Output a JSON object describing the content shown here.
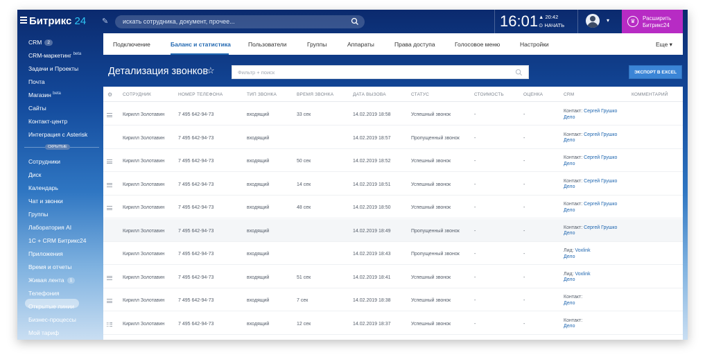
{
  "app": {
    "logo_main": "Битрикс",
    "logo_num": " 24",
    "search_placeholder": "искать сотрудника, документ, прочее...",
    "time": "16:01",
    "workday_time": "▲ 20:42",
    "workday_action": "⊙ НАЧАТЬ",
    "upgrade_line1": "Расширить",
    "upgrade_line2": "Битрикс24"
  },
  "sidebar": {
    "items": [
      {
        "label": "CRM",
        "badge": "2",
        "sup": ""
      },
      {
        "label": "CRM-маркетинг",
        "badge": "",
        "sup": "beta"
      },
      {
        "label": "Задачи и Проекты",
        "badge": "",
        "sup": ""
      },
      {
        "label": "Почта",
        "badge": "",
        "sup": ""
      },
      {
        "label": "Магазин",
        "badge": "",
        "sup": "beta"
      },
      {
        "label": "Сайты",
        "badge": "",
        "sup": ""
      },
      {
        "label": "Контакт-центр",
        "badge": "",
        "sup": ""
      },
      {
        "label": "Интеграция с Asterisk",
        "badge": "",
        "sup": ""
      }
    ],
    "hidden_label": "СКРЫТЫЕ",
    "hidden_items": [
      {
        "label": "Сотрудники",
        "badge": ""
      },
      {
        "label": "Диск",
        "badge": ""
      },
      {
        "label": "Календарь",
        "badge": ""
      },
      {
        "label": "Чат и звонки",
        "badge": ""
      },
      {
        "label": "Группы",
        "badge": ""
      },
      {
        "label": "Лаборатория AI",
        "badge": ""
      },
      {
        "label": "1С + CRM Битрикс24",
        "badge": ""
      },
      {
        "label": "Приложения",
        "badge": ""
      },
      {
        "label": "Время и отчеты",
        "badge": ""
      },
      {
        "label": "Живая лента",
        "badge": "1"
      },
      {
        "label": "Телефония",
        "badge": ""
      },
      {
        "label": "Открытые линии",
        "badge": ""
      },
      {
        "label": "Бизнес-процессы",
        "badge": ""
      },
      {
        "label": "Мой тариф",
        "badge": ""
      }
    ],
    "active_index": 10
  },
  "tabs": [
    {
      "label": "Подключение"
    },
    {
      "label": "Баланс и статистика"
    },
    {
      "label": "Пользователи"
    },
    {
      "label": "Группы"
    },
    {
      "label": "Аппараты"
    },
    {
      "label": "Права доступа"
    },
    {
      "label": "Голосовое меню"
    },
    {
      "label": "Настройки"
    },
    {
      "label": "Еще ▾"
    }
  ],
  "active_tab": 1,
  "page": {
    "title": "Детализация звонков",
    "filter_placeholder": "Фильтр + поиск",
    "excel_button": "ЭКСПОРТ В EXCEL"
  },
  "columns": [
    "СОТРУДНИК",
    "НОМЕР ТЕЛЕФОНА",
    "ТИП ЗВОНКА",
    "ВРЕМЯ ЗВОНКА",
    "ДАТА ВЫЗОВА",
    "СТАТУС",
    "СТОИМОСТЬ",
    "ОЦЕНКА",
    "CRM",
    "КОММЕНТАРИЙ"
  ],
  "rows": [
    {
      "handle": true,
      "employee": "Кирилл Золотавин",
      "phone": "7 495 642-94-73",
      "type": "входящий",
      "duration": "33 сек",
      "date": "14.02.2019 18:58",
      "status": "Успешный звонок",
      "cost": "-",
      "rating": "-",
      "crm_label": "Контакт: ",
      "crm_link": "Сергей Грушко",
      "crm_deal": "Дело",
      "comment": ""
    },
    {
      "handle": false,
      "employee": "Кирилл Золотавин",
      "phone": "7 495 642-94-73",
      "type": "входящий",
      "duration": "",
      "date": "14.02.2019 18:57",
      "status": "Пропущенный звонок",
      "cost": "-",
      "rating": "-",
      "crm_label": "Контакт: ",
      "crm_link": "Сергей Грушко",
      "crm_deal": "Дело",
      "comment": ""
    },
    {
      "handle": true,
      "employee": "Кирилл Золотавин",
      "phone": "7 495 642-94-73",
      "type": "входящий",
      "duration": "50 сек",
      "date": "14.02.2019 18:52",
      "status": "Успешный звонок",
      "cost": "-",
      "rating": "-",
      "crm_label": "Контакт: ",
      "crm_link": "Сергей Грушко",
      "crm_deal": "Дело",
      "comment": ""
    },
    {
      "handle": true,
      "employee": "Кирилл Золотавин",
      "phone": "7 495 642-94-73",
      "type": "входящий",
      "duration": "14 сек",
      "date": "14.02.2019 18:51",
      "status": "Успешный звонок",
      "cost": "-",
      "rating": "-",
      "crm_label": "Контакт: ",
      "crm_link": "Сергей Грушко",
      "crm_deal": "Дело",
      "comment": ""
    },
    {
      "handle": true,
      "employee": "Кирилл Золотавин",
      "phone": "7 495 642-94-73",
      "type": "входящий",
      "duration": "48 сек",
      "date": "14.02.2019 18:50",
      "status": "Успешный звонок",
      "cost": "-",
      "rating": "-",
      "crm_label": "Контакт: ",
      "crm_link": "Сергей Грушко",
      "crm_deal": "Дело",
      "comment": ""
    },
    {
      "handle": false,
      "employee": "Кирилл Золотавин",
      "phone": "7 495 642-94-73",
      "type": "входящий",
      "duration": "",
      "date": "14.02.2019 18:49",
      "status": "Пропущенный звонок",
      "cost": "-",
      "rating": "-",
      "crm_label": "Контакт: ",
      "crm_link": "Сергей Грушко",
      "crm_deal": "Дело",
      "comment": ""
    },
    {
      "handle": false,
      "employee": "Кирилл Золотавин",
      "phone": "7 495 642-94-73",
      "type": "входящий",
      "duration": "",
      "date": "14.02.2019 18:43",
      "status": "Пропущенный звонок",
      "cost": "-",
      "rating": "-",
      "crm_label": "Лид: ",
      "crm_link": "Voxlink",
      "crm_deal": "Дело",
      "comment": ""
    },
    {
      "handle": true,
      "employee": "Кирилл Золотавин",
      "phone": "7 495 642-94-73",
      "type": "входящий",
      "duration": "51 сек",
      "date": "14.02.2019 18:41",
      "status": "Успешный звонок",
      "cost": "-",
      "rating": "-",
      "crm_label": "Лид: ",
      "crm_link": "Voxlink",
      "crm_deal": "Дело",
      "comment": ""
    },
    {
      "handle": true,
      "employee": "Кирилл Золотавин",
      "phone": "7 495 642-94-73",
      "type": "входящий",
      "duration": "7 сек",
      "date": "14.02.2019 18:38",
      "status": "Успешный звонок",
      "cost": "-",
      "rating": "-",
      "crm_label": "Контакт:",
      "crm_link": "",
      "crm_deal": "Дело",
      "comment": ""
    },
    {
      "handle": true,
      "employee": "Кирилл Золотавин",
      "phone": "7 495 642-94-73",
      "type": "входящий",
      "duration": "12 сек",
      "date": "14.02.2019 18:37",
      "status": "Успешный звонок",
      "cost": "-",
      "rating": "-",
      "crm_label": "Контакт:",
      "crm_link": "",
      "crm_deal": "Дело",
      "comment": ""
    }
  ]
}
